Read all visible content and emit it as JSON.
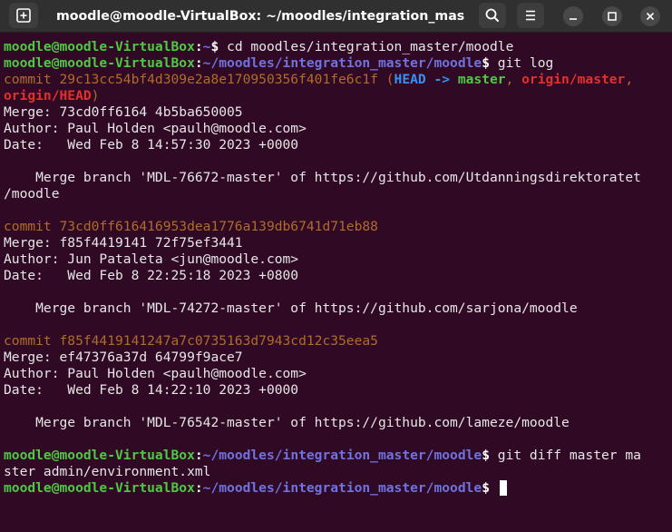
{
  "window": {
    "title": "moodle@moodle-VirtualBox: ~/moodles/integration_master..."
  },
  "icons": {
    "new_tab": "new-tab-icon",
    "search": "search-icon",
    "menu": "hamburger-menu-icon",
    "minimize": "minimize-icon",
    "maximize": "maximize-icon",
    "close": "close-icon"
  },
  "colors": {
    "background": "#300a24",
    "titlebar": "#303030",
    "user_host": "#4ec943",
    "path": "#6f72df",
    "commit_hash": "#b06c2a",
    "head_ref": "#3a8ff0",
    "remote_ref": "#e4302c"
  },
  "terminal": {
    "user_host": "moodle@moodle-VirtualBox",
    "prompt_sep": ":",
    "prompt_end": "$",
    "cmd1": {
      "path": "~",
      "command": " cd moodles/integration_master/moodle"
    },
    "cmd2": {
      "path": "~/moodles/integration_master/moodle",
      "command": " git log"
    },
    "commits": [
      {
        "hash_line": "commit 29c13cc54bf4d309e2a8e170950356f401fe6c1f",
        "ref_open": " (",
        "ref_head": "HEAD -> ",
        "ref_branch": "master",
        "ref_comma1": ", ",
        "ref_origin_master": "origin/master",
        "ref_comma2": ",",
        "ref_origin_head": "origin/HEAD",
        "ref_close": ")",
        "merge": "Merge: 73cd0ff6164 4b5ba650005",
        "author": "Author: Paul Holden <paulh@moodle.com>",
        "date": "Date:   Wed Feb 8 14:57:30 2023 +0000",
        "message": "    Merge branch 'MDL-76672-master' of https://github.com/Utdanningsdirektoratet",
        "message_cont": "/moodle"
      },
      {
        "hash_line": "commit 73cd0ff616416953dea1776a139db6741d71eb88",
        "merge": "Merge: f85f4419141 72f75ef3441",
        "author": "Author: Jun Pataleta <jun@moodle.com>",
        "date": "Date:   Wed Feb 8 22:25:18 2023 +0800",
        "message": "    Merge branch 'MDL-74272-master' of https://github.com/sarjona/moodle"
      },
      {
        "hash_line": "commit f85f4419141247a7c0735163d7943cd12c35eea5",
        "merge": "Merge: ef47376a37d 64799f9ace7",
        "author": "Author: Paul Holden <paulh@moodle.com>",
        "date": "Date:   Wed Feb 8 14:22:10 2023 +0000",
        "message": "    Merge branch 'MDL-76542-master' of https://github.com/lameze/moodle"
      }
    ],
    "cmd3": {
      "path": "~/moodles/integration_master/moodle",
      "command": " git diff master ma",
      "command_cont": "ster admin/environment.xml"
    },
    "cmd4": {
      "path": "~/moodles/integration_master/moodle",
      "command": " "
    }
  }
}
